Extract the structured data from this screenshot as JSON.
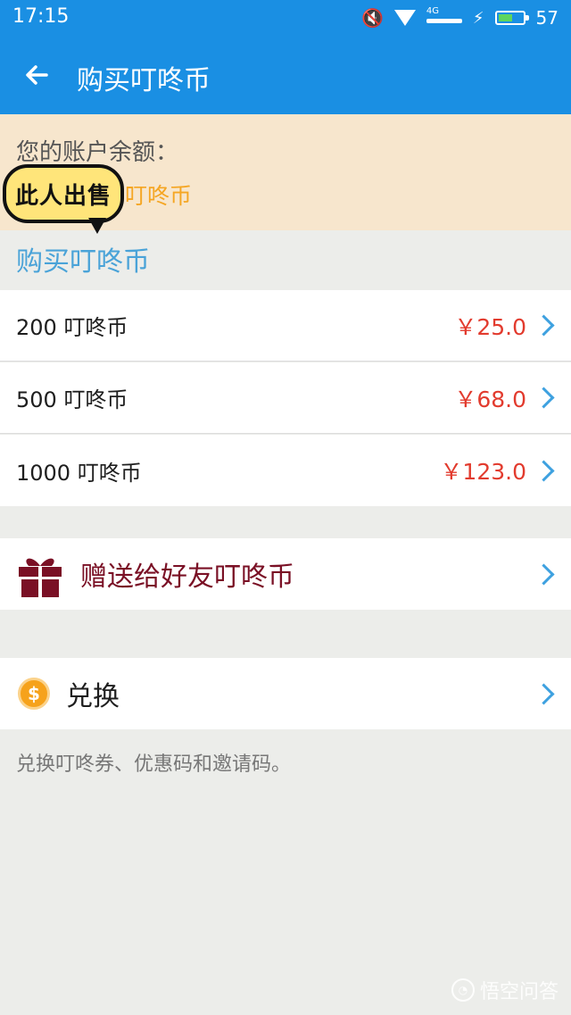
{
  "status_bar": {
    "time": "17:15",
    "network": "4G",
    "battery_level": "57",
    "battery_fraction": 0.57
  },
  "app_bar": {
    "title": "购买叮咚币"
  },
  "balance": {
    "label": "您的账户余额：",
    "unit": "叮咚币"
  },
  "sticker": {
    "text": "此人出售"
  },
  "purchase": {
    "heading": "购买叮咚币",
    "options": [
      {
        "label": "200 叮咚币",
        "price": "￥25.0"
      },
      {
        "label": "500 叮咚币",
        "price": "￥68.0"
      },
      {
        "label": "1000 叮咚币",
        "price": "￥123.0"
      }
    ]
  },
  "gift": {
    "label": "赠送给好友叮咚币"
  },
  "exchange": {
    "label": "兑换",
    "hint": "兑换叮咚券、优惠码和邀请码。"
  },
  "watermark": {
    "text": "悟空问答"
  },
  "colors": {
    "primary": "#1a8fe3",
    "price": "#e23b2e",
    "accent_link": "#3ea1e0",
    "balance_bg": "#f7e6cd",
    "balance_unit": "#f5a623",
    "gift": "#7a1025",
    "coin": "#f6a21b"
  }
}
